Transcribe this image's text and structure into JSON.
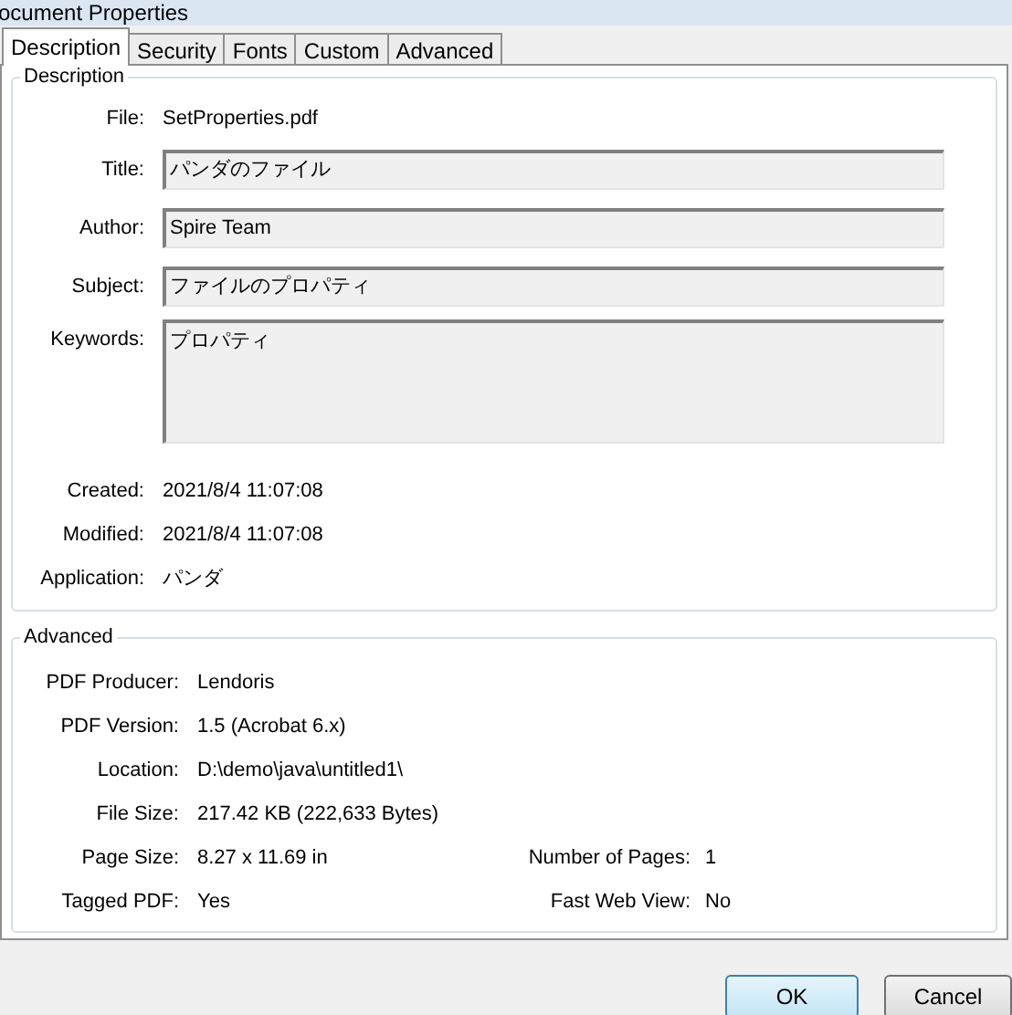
{
  "window": {
    "title": "ocument Properties"
  },
  "tabs": [
    {
      "label": "Description",
      "selected": true
    },
    {
      "label": "Security",
      "selected": false
    },
    {
      "label": "Fonts",
      "selected": false
    },
    {
      "label": "Custom",
      "selected": false
    },
    {
      "label": "Advanced",
      "selected": false
    }
  ],
  "description": {
    "title": "Description",
    "rows": [
      {
        "kind": "text",
        "label": "File:",
        "value": "SetProperties.pdf"
      },
      {
        "kind": "field",
        "label": "Title:",
        "value": "パンダのファイル"
      },
      {
        "kind": "field",
        "label": "Author:",
        "value": "Spire Team"
      },
      {
        "kind": "field",
        "label": "Subject:",
        "value": "ファイルのプロパティ"
      },
      {
        "kind": "area",
        "label": "Keywords:",
        "value": "プロパティ"
      },
      {
        "kind": "text",
        "label": "Created:",
        "value": "2021/8/4 11:07:08"
      },
      {
        "kind": "text",
        "label": "Modified:",
        "value": "2021/8/4 11:07:08"
      },
      {
        "kind": "text",
        "label": "Application:",
        "value": "パンダ"
      }
    ]
  },
  "advanced": {
    "title": "Advanced",
    "rows": [
      {
        "label": "PDF Producer:",
        "value": "Lendoris"
      },
      {
        "label": "PDF Version:",
        "value": "1.5 (Acrobat 6.x)"
      },
      {
        "label": "Location:",
        "value": "D:\\demo\\java\\untitled1\\"
      },
      {
        "label": "File Size:",
        "value": "217.42 KB (222,633 Bytes)"
      },
      {
        "label": "Page Size:",
        "value": "8.27 x 11.69 in",
        "label_2": "Number of Pages:",
        "value_2": "1"
      },
      {
        "label": "Tagged PDF:",
        "value": "Yes",
        "label_2": "Fast Web View:",
        "value_2": "No"
      }
    ]
  },
  "buttons": [
    {
      "label": "OK",
      "default": true
    },
    {
      "label": "Cancel",
      "default": false
    }
  ]
}
